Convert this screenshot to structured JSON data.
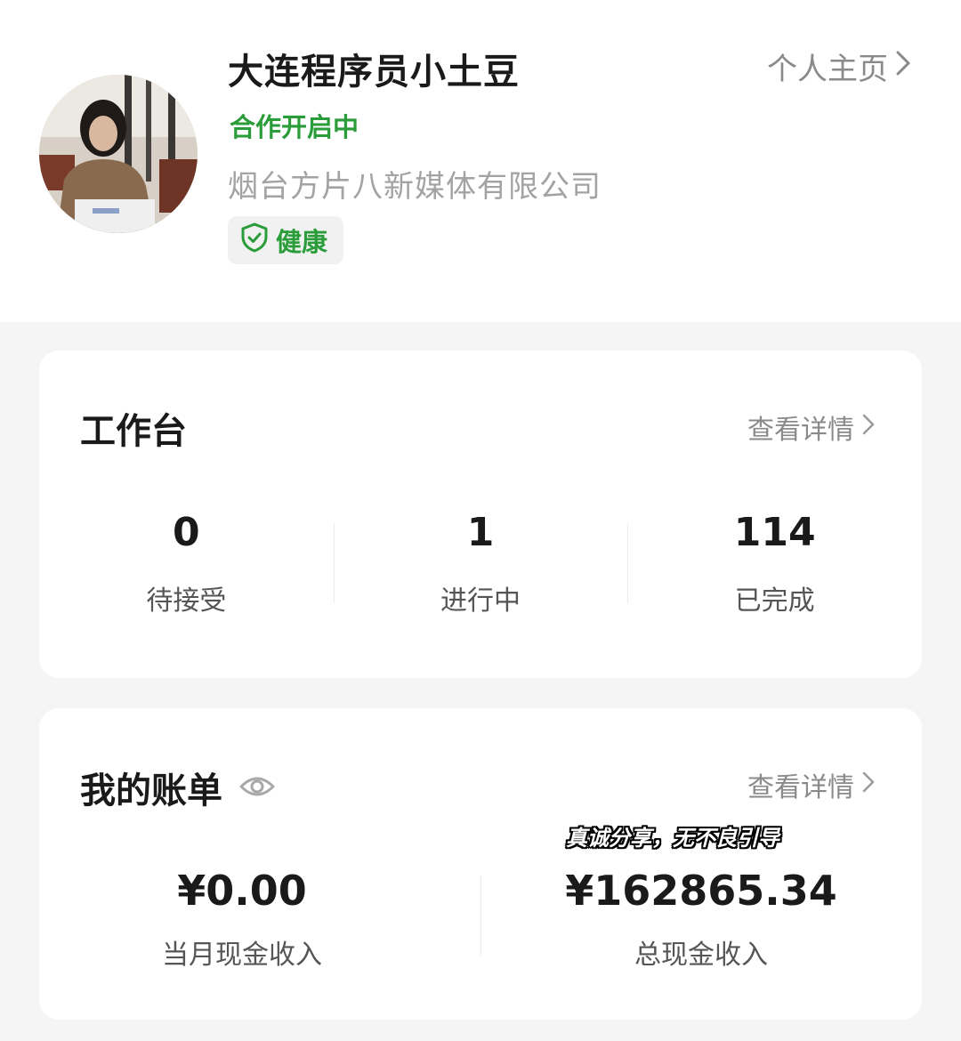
{
  "profile": {
    "name": "大连程序员小土豆",
    "status": "合作开启中",
    "company": "烟台方片八新媒体有限公司",
    "health_label": "健康",
    "homepage_label": "个人主页",
    "icons": {
      "health": "shield-check-icon",
      "homepage": "chevron-right-icon"
    }
  },
  "workbench": {
    "title": "工作台",
    "details_label": "查看详情",
    "stats": [
      {
        "value": "0",
        "label": "待接受"
      },
      {
        "value": "1",
        "label": "进行中"
      },
      {
        "value": "114",
        "label": "已完成"
      }
    ]
  },
  "bill": {
    "title": "我的账单",
    "details_label": "查看详情",
    "monthly": {
      "value": "¥0.00",
      "label": "当月现金收入"
    },
    "total": {
      "value": "¥162865.34",
      "label": "总现金收入"
    },
    "icons": {
      "visibility": "eye-icon"
    }
  },
  "overlay_caption": "真诚分享，无不良引导",
  "colors": {
    "accent_green": "#2a9d3a",
    "muted_text": "#8a8a8a",
    "background": "#f5f5f5",
    "card": "#ffffff"
  }
}
